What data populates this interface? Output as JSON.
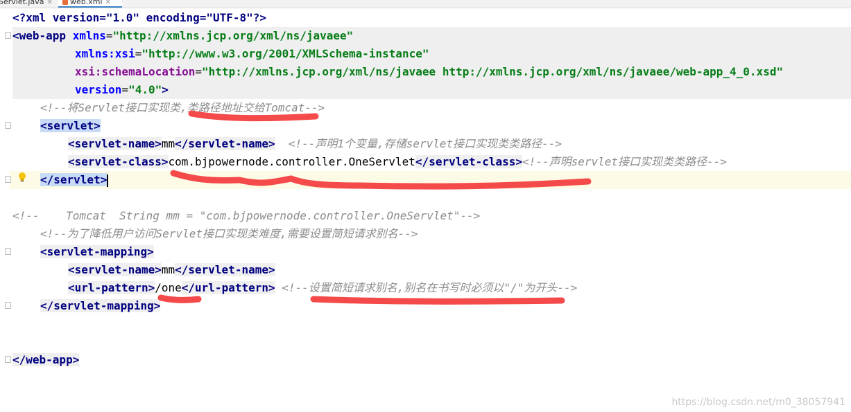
{
  "tabs": [
    {
      "label": "Servlet.java",
      "close": "✕"
    },
    {
      "label": "web.xml",
      "close": "✕"
    }
  ],
  "code": {
    "l1_decl": "<?xml version=\"1.0\" encoding=\"UTF-8\"?>",
    "l2_open": "<web-app",
    "l2_attr": "xmlns",
    "l2_val": "\"http://xmlns.jcp.org/xml/ns/javaee\"",
    "l3_attr": "xmlns:xsi",
    "l3_val": "\"http://www.w3.org/2001/XMLSchema-instance\"",
    "l4_attr": "xsi:schemaLocation",
    "l4_val": "\"http://xmlns.jcp.org/xml/ns/javaee http://xmlns.jcp.org/xml/ns/javaee/web-app_4_0.xsd\"",
    "l5_attr": "version",
    "l5_val": "\"4.0\"",
    "l6_comment": "<!--将Servlet接口实现类,类路径地址交给Tomcat-->",
    "l7_tag": "<servlet>",
    "l8_open": "<servlet-name>",
    "l8_text": "mm",
    "l8_close": "</servlet-name>",
    "l8_comment": "<!--声明1个变量,存储servlet接口实现类类路径-->",
    "l9_open": "<servlet-class>",
    "l9_text": "com.bjpowernode.controller.OneServlet",
    "l9_close": "</servlet-class>",
    "l9_comment": "<!--声明servlet接口实现类类路径-->",
    "l10_tag": "</servlet>",
    "l12_comment": "<!--    Tomcat  String mm = \"com.bjpowernode.controller.OneServlet\"-->",
    "l13_comment": "<!--为了降低用户访问Servlet接口实现类难度,需要设置简短请求别名-->",
    "l14_tag": "<servlet-mapping>",
    "l15_open": "<servlet-name>",
    "l15_text": "mm",
    "l15_close": "</servlet-name>",
    "l16_open": "<url-pattern>",
    "l16_text": "/one",
    "l16_close": "</url-pattern>",
    "l16_comment": "<!--设置简短请求别名,别名在书写时必须以\"/\"为开头-->",
    "l17_tag": "</servlet-mapping>",
    "l20_tag": "</web-app>"
  },
  "watermark": "https://blog.csdn.net/m0_38057941",
  "annotation_color": "#f54a4a"
}
